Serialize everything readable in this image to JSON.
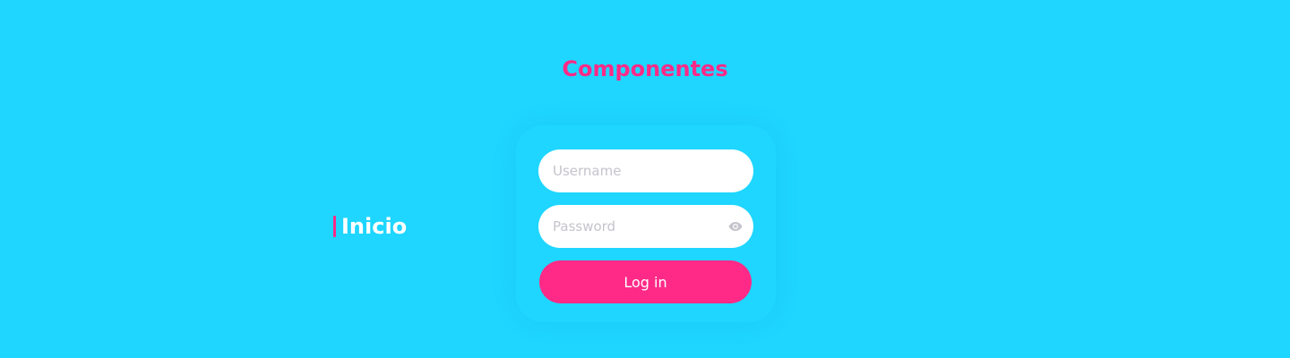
{
  "header": {
    "title": "Componentes"
  },
  "section": {
    "label": "Inicio"
  },
  "login_form": {
    "username_placeholder": "Username",
    "username_value": "",
    "password_placeholder": "Password",
    "password_value": "",
    "password_toggle_icon": "eye-icon",
    "submit_label": "Log in"
  },
  "colors": {
    "background": "#1ed6ff",
    "accent": "#ff2a87",
    "field_background": "#ffffff",
    "placeholder": "#c4c4cc",
    "label_text": "#ffffff"
  }
}
